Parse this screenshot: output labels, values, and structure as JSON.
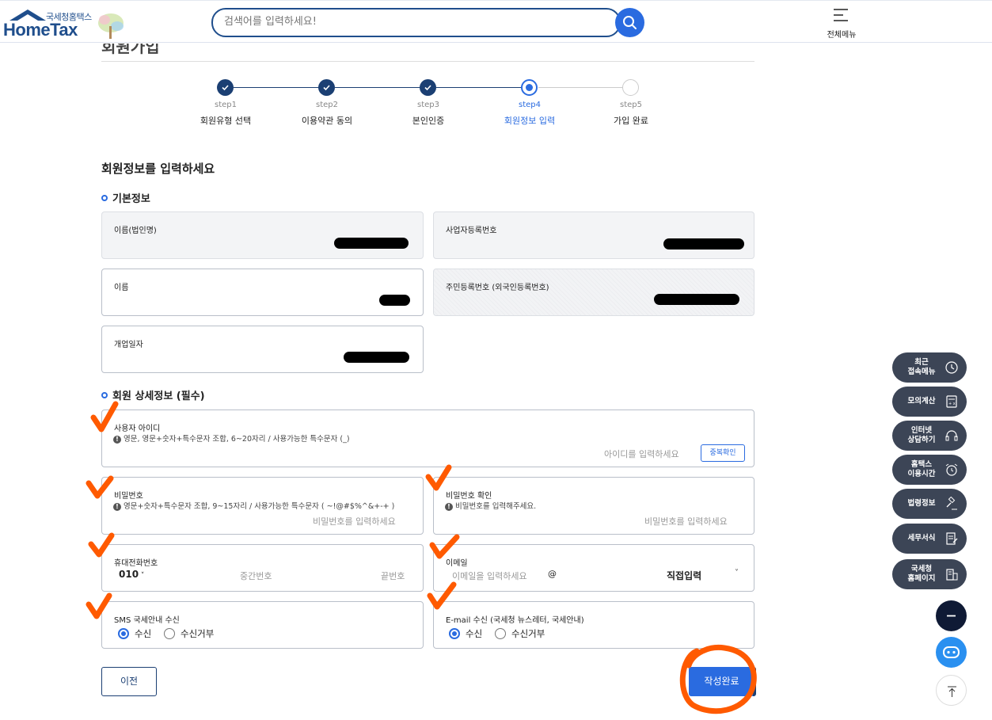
{
  "header": {
    "logo_sub": "국세청홈택스",
    "logo_main": "HomeTax",
    "search_placeholder": "검색어를 입력하세요!",
    "menu_label": "전체메뉴"
  },
  "page": {
    "title": "회원가입",
    "section_title": "회원정보를 입력하세요"
  },
  "steps": [
    {
      "num": "step1",
      "name": "회원유형 선택",
      "state": "done"
    },
    {
      "num": "step2",
      "name": "이용약관 동의",
      "state": "done"
    },
    {
      "num": "step3",
      "name": "본인인증",
      "state": "done"
    },
    {
      "num": "step4",
      "name": "회원정보 입력",
      "state": "current"
    },
    {
      "num": "step5",
      "name": "가입 완료",
      "state": "todo"
    }
  ],
  "basic": {
    "title": "기본정보",
    "corp_name_label": "이름(법인명)",
    "biz_no_label": "사업자등록번호",
    "name_label": "이름",
    "rrn_label": "주민등록번호 (외국인등록번호)",
    "open_date_label": "개업일자"
  },
  "detail": {
    "title": "회원 상세정보 (필수)",
    "id_label": "사용자 아이디",
    "id_hint": "영문, 영문+숫자+특수문자 조합, 6~20자리 / 사용가능한 특수문자 (_)",
    "id_placeholder": "아이디를 입력하세요",
    "dup_check": "중복확인",
    "pw_label": "비밀번호",
    "pw_hint": "영문+숫자+특수문자 조합, 9~15자리 / 사용가능한 특수문자 ( ~!@#$%^&+-+ )",
    "pw_placeholder": "비밀번호를 입력하세요",
    "pw2_label": "비밀번호 확인",
    "pw2_hint": "비밀번호를 입력해주세요.",
    "pw2_placeholder": "비밀번호를 입력하세요",
    "phone_label": "휴대전화번호",
    "phone_prefix": "010",
    "phone_mid": "중간번호",
    "phone_end": "끝번호",
    "email_label": "이메일",
    "email_placeholder": "이메일을 입력하세요",
    "email_at": "@",
    "email_domain": "직접입력",
    "sms_label": "SMS 국세안내 수신",
    "email_recv_label": "E-mail 수신 (국세청 뉴스레터, 국세안내)",
    "opt_yes": "수신",
    "opt_no": "수신거부"
  },
  "buttons": {
    "prev": "이전",
    "submit": "작성완료"
  },
  "quick_menu": [
    {
      "label": "최근\n접속메뉴",
      "icon": "clock-icon"
    },
    {
      "label": "모의계산",
      "icon": "calculator-icon"
    },
    {
      "label": "인터넷\n상담하기",
      "icon": "headset-icon"
    },
    {
      "label": "홈택스\n이용시간",
      "icon": "alarm-icon"
    },
    {
      "label": "법령정보",
      "icon": "gavel-icon"
    },
    {
      "label": "세무서식",
      "icon": "form-icon"
    },
    {
      "label": "국세청\n홈페이지",
      "icon": "building-icon"
    }
  ],
  "colors": {
    "primary": "#2a6be0",
    "navy": "#1b3f73",
    "quick_menu_bg": "#3c4556",
    "annotation": "#ff5a00"
  }
}
